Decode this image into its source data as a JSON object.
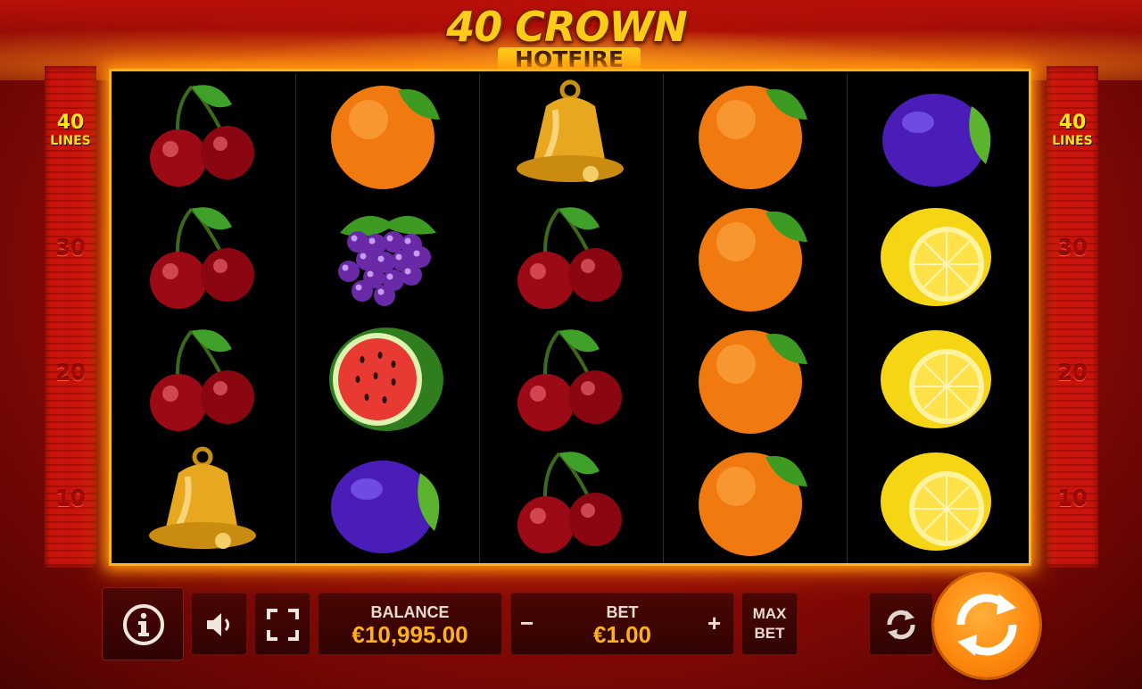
{
  "game": {
    "logo_main": "40 CROWN",
    "logo_sub": "HOTFIRE"
  },
  "paylines": {
    "top_number": "40",
    "top_label": "LINES",
    "marks": [
      "30",
      "20",
      "10"
    ]
  },
  "reels": [
    [
      "cherry",
      "cherry",
      "cherry",
      "bell"
    ],
    [
      "orange",
      "grapes",
      "watermelon",
      "plum"
    ],
    [
      "bell",
      "cherry",
      "cherry",
      "cherry"
    ],
    [
      "orange",
      "orange",
      "orange",
      "orange"
    ],
    [
      "plum",
      "lemon",
      "lemon",
      "lemon"
    ]
  ],
  "controls": {
    "info_icon": "info-icon",
    "sound_icon": "speaker-icon",
    "fullscreen_icon": "fullscreen-icon",
    "balance_label": "BALANCE",
    "balance_value": "€10,995.00",
    "bet_label": "BET",
    "bet_value": "€1.00",
    "bet_minus": "−",
    "bet_plus": "+",
    "maxbet_line1": "MAX",
    "maxbet_line2": "BET",
    "autoplay_icon": "autoplay-icon",
    "spin_icon": "spin-icon"
  },
  "colors": {
    "accent_gold": "#ffb41e",
    "value_orange": "#ffb01a",
    "spin_orange": "#ff8a10",
    "background_red": "#9a0c07"
  }
}
